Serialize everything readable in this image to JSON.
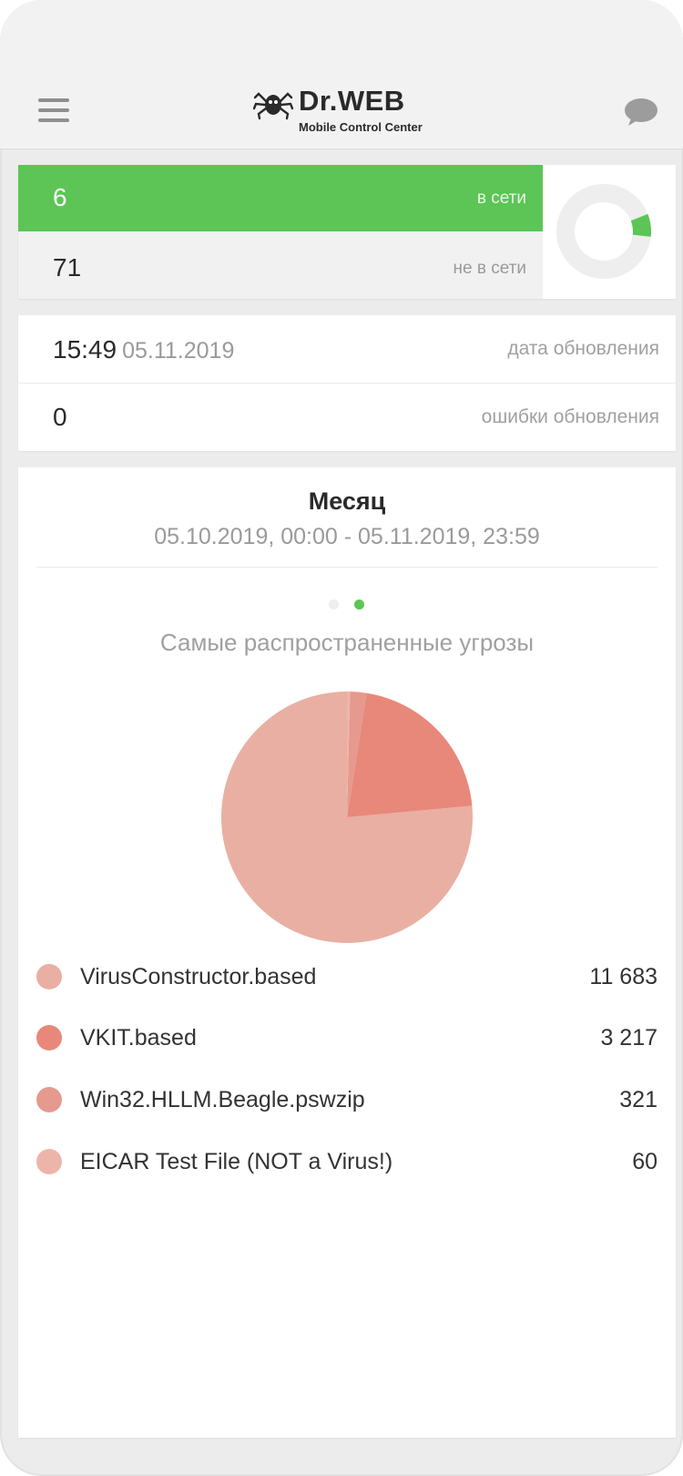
{
  "app": {
    "brand": "Dr.WEB",
    "brand_subtitle": "Mobile Control Center"
  },
  "icons": {
    "menu": "hamburger-menu-icon",
    "logo": "spider-logo-icon",
    "chat": "chat-bubble-icon"
  },
  "colors": {
    "online_green": "#5cc556",
    "offline_gray": "#f1f1f1",
    "donut_track": "#eeeeee",
    "page_bg": "#ececec"
  },
  "status": {
    "online_count": "6",
    "online_label": "в сети",
    "offline_count": "71",
    "offline_label": "не в сети",
    "online_fraction": 0.078
  },
  "update": {
    "time": "15:49",
    "date": "05.11.2019",
    "date_label": "дата обновления",
    "errors_count": "0",
    "errors_label": "ошибки обновления"
  },
  "period": {
    "title": "Месяц",
    "range": "05.10.2019, 00:00 - 05.11.2019, 23:59"
  },
  "pager": {
    "count": 2,
    "active_index": 1,
    "active_color": "#5cc556",
    "inactive_color": "#eeeeee"
  },
  "chart_data": {
    "type": "pie",
    "title": "Самые распространенные угрозы",
    "series": [
      {
        "name": "VirusConstructor.based",
        "value": 11683,
        "display": "11 683",
        "color": "#e9afa3"
      },
      {
        "name": "VKIT.based",
        "value": 3217,
        "display": "3 217",
        "color": "#e8887a"
      },
      {
        "name": "Win32.HLLM.Beagle.pswzip",
        "value": 321,
        "display": "321",
        "color": "#e6998d"
      },
      {
        "name": "EICAR Test File (NOT a Virus!)",
        "value": 60,
        "display": "60",
        "color": "#edb5aa"
      }
    ]
  }
}
